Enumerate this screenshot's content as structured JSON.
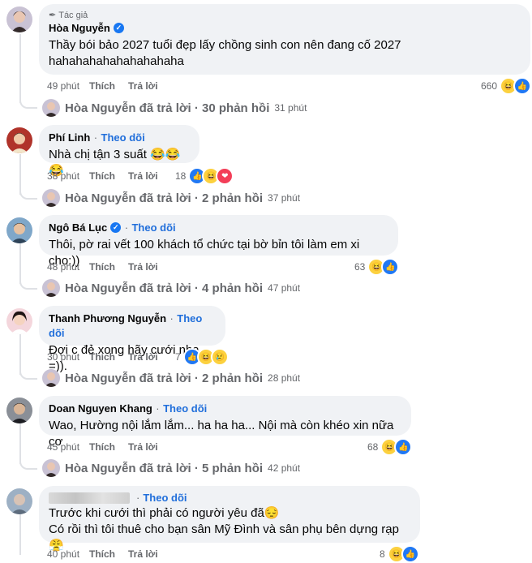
{
  "comments": [
    {
      "author_tag": "Tác giả",
      "name": "Hòa Nguyễn",
      "verified": true,
      "follow": "",
      "text_lines": [
        "Thầy bói bảo 2027 tuổi đẹp lấy chồng sinh con nên đang cố 2027",
        "hahahahahahahahahaha"
      ],
      "time": "49 phút",
      "like": "Thích",
      "reply": "Trả lời",
      "reaction_count": "660",
      "reactions": [
        "haha",
        "like"
      ],
      "replies": {
        "author": "Hòa Nguyễn",
        "text": "Hòa Nguyễn đã trả lời · 30 phản hồi",
        "time": "31 phút"
      }
    },
    {
      "name": "Phí Linh",
      "verified": false,
      "follow": "Theo dõi",
      "text_lines": [
        "Nhà chị tận 3 suất 😂😂😂"
      ],
      "time": "38 phút",
      "like": "Thích",
      "reply": "Trả lời",
      "reaction_count": "18",
      "reactions": [
        "like",
        "haha",
        "love"
      ],
      "replies": {
        "author": "Hòa Nguyễn",
        "text": "Hòa Nguyễn đã trả lời · 2 phản hồi",
        "time": "37 phút"
      }
    },
    {
      "name": "Ngô Bá Lục",
      "verified": true,
      "follow": "Theo dõi",
      "text_lines": [
        "Thôi, pờ rai vết 100 khách tổ chức tại bờ bỉn tôi làm em xi cho:))"
      ],
      "time": "48 phút",
      "like": "Thích",
      "reply": "Trả lời",
      "reaction_count": "63",
      "reactions": [
        "haha",
        "like"
      ],
      "replies": {
        "author": "Hòa Nguyễn",
        "text": "Hòa Nguyễn đã trả lời · 4 phản hồi",
        "time": "47 phút"
      }
    },
    {
      "name": "Thanh Phương Nguyễn",
      "verified": false,
      "follow": "Theo dõi",
      "text_lines": [
        "Đợi c đẻ xong hãy cưới nha =))."
      ],
      "time": "30 phút",
      "like": "Thích",
      "reply": "Trả lời",
      "reaction_count": "7",
      "reactions": [
        "like",
        "haha",
        "sad"
      ],
      "replies": {
        "author": "Hòa Nguyễn",
        "text": "Hòa Nguyễn đã trả lời · 2 phản hồi",
        "time": "28 phút"
      }
    },
    {
      "name": "Doan Nguyen Khang",
      "verified": false,
      "follow": "Theo dõi",
      "text_lines": [
        "Wao, Hường nội lắm lắm... ha ha ha... Nội mà còn khéo xin nữa cơ"
      ],
      "time": "45 phút",
      "like": "Thích",
      "reply": "Trả lời",
      "reaction_count": "68",
      "reactions": [
        "haha",
        "like"
      ],
      "replies": {
        "author": "Hòa Nguyễn",
        "text": "Hòa Nguyễn đã trả lời · 5 phản hồi",
        "time": "42 phút"
      }
    },
    {
      "name": "",
      "verified": false,
      "follow": "Theo dõi",
      "text_lines": [
        "Trước khi cưới thì phải có người yêu đã😔",
        "Có rồi thì tôi thuê cho bạn sân Mỹ Đình và sân phụ bên dựng rạp😤"
      ],
      "time": "40 phút",
      "like": "Thích",
      "reply": "Trả lời",
      "reaction_count": "8",
      "reactions": [
        "haha",
        "like"
      ]
    }
  ],
  "separator": "·",
  "colors": {
    "accent": "#216fdb",
    "bubble": "#f0f2f5",
    "meta": "#65676b"
  }
}
